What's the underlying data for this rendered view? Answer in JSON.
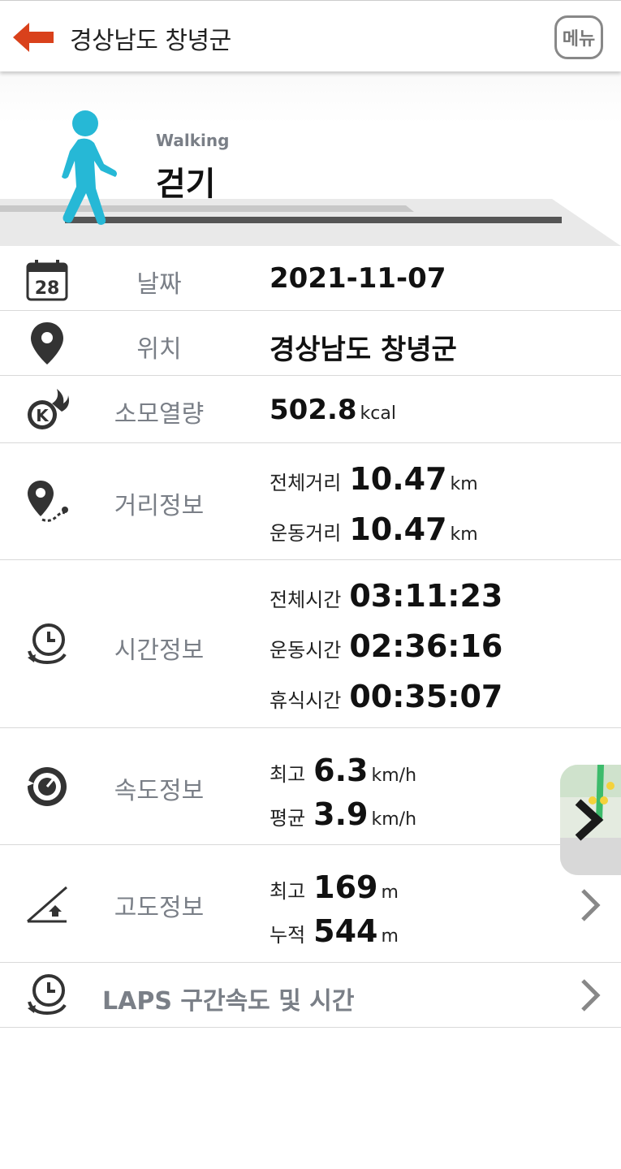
{
  "header": {
    "title": "경상남도 창녕군",
    "menu_label": "메뉴"
  },
  "activity": {
    "name_en": "Walking",
    "name_ko": "걷기"
  },
  "rows": {
    "date": {
      "label": "날짜",
      "value": "2021-11-07"
    },
    "location": {
      "label": "위치",
      "value": "경상남도 창녕군"
    },
    "calories": {
      "label": "소모열량",
      "value": "502.8",
      "unit": "kcal"
    },
    "distance": {
      "label": "거리정보",
      "total_label": "전체거리",
      "total_value": "10.47",
      "total_unit": "km",
      "moving_label": "운동거리",
      "moving_value": "10.47",
      "moving_unit": "km"
    },
    "time": {
      "label": "시간정보",
      "total_label": "전체시간",
      "total_value": "03:11:23",
      "moving_label": "운동시간",
      "moving_value": "02:36:16",
      "rest_label": "휴식시간",
      "rest_value": "00:35:07"
    },
    "speed": {
      "label": "속도정보",
      "max_label": "최고",
      "max_value": "6.3",
      "max_unit": "km/h",
      "avg_label": "평균",
      "avg_value": "3.9",
      "avg_unit": "km/h"
    },
    "altitude": {
      "label": "고도정보",
      "max_label": "최고",
      "max_value": "169",
      "max_unit": "m",
      "total_label": "누적",
      "total_value": "544",
      "total_unit": "m"
    },
    "laps": {
      "label": "LAPS 구간속도 및 시간"
    }
  },
  "icons": {
    "back": "arrow-left-icon",
    "calendar": "calendar-icon",
    "calendar_day": "28",
    "location": "map-pin-icon",
    "calories": "calorie-flame-icon",
    "distance": "route-pin-icon",
    "time": "clock-icon",
    "speed": "speedometer-icon",
    "altitude": "altitude-slope-icon",
    "chevron": "chevron-right-icon"
  },
  "colors": {
    "accent": "#d9411b",
    "walker": "#26b8d6",
    "label_gray": "#7a7f87"
  }
}
